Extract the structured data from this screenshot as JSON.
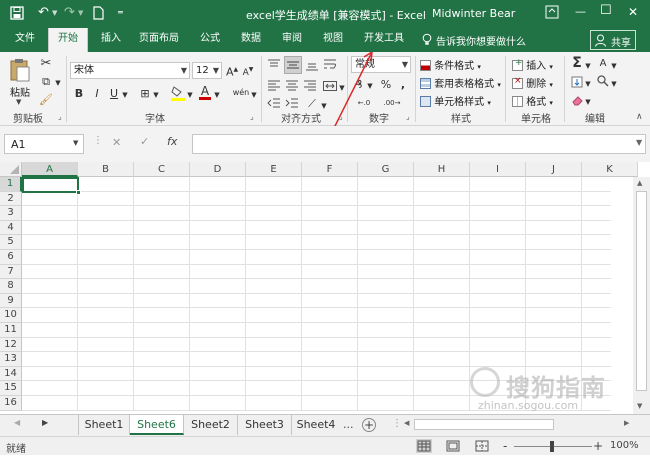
{
  "titlebar": {
    "title": "excel学生成绩单  [兼容模式]  -  Excel",
    "user": "Midwinter Bear",
    "save_icon": "save-icon",
    "undo_icon": "undo-icon",
    "redo_icon": "redo-icon",
    "new_icon": "new-file-icon",
    "customize_icon": "customize-toolbar-icon",
    "ribbon_options_icon": "ribbon-display-icon",
    "minimize_glyph": "—",
    "restore_glyph": "☐",
    "close_glyph": "✕"
  },
  "menu": {
    "tabs": [
      "文件",
      "开始",
      "插入",
      "页面布局",
      "公式",
      "数据",
      "审阅",
      "视图",
      "开发工具"
    ],
    "active_tab": "开始",
    "tell_me": "告诉我你想要做什么",
    "share": "共享"
  },
  "ribbon": {
    "clipboard": {
      "label": "剪贴板",
      "paste": "粘贴"
    },
    "font": {
      "label": "字体",
      "font_name": "宋体",
      "font_size": "12",
      "grow": "A",
      "shrink": "A",
      "bold": "B",
      "italic": "I",
      "underline": "U",
      "font_color_letter": "A",
      "phonetic": "wén"
    },
    "alignment": {
      "label": "对齐方式"
    },
    "number": {
      "label": "数字",
      "format": "常规",
      "percent": "%",
      "comma": ","
    },
    "styles": {
      "label": "样式",
      "conditional": "条件格式",
      "table": "套用表格格式",
      "cell_styles": "单元格样式"
    },
    "cells": {
      "label": "单元格",
      "insert": "插入",
      "delete": "删除",
      "format": "格式"
    },
    "editing": {
      "label": "编辑",
      "sum": "Σ"
    }
  },
  "formula_bar": {
    "name_box": "A1",
    "cancel": "✕",
    "enter": "✓",
    "fx": "fx",
    "value": ""
  },
  "grid": {
    "columns": [
      "A",
      "B",
      "C",
      "D",
      "E",
      "F",
      "G",
      "H",
      "I",
      "J",
      "K"
    ],
    "rows": [
      "1",
      "2",
      "3",
      "4",
      "5",
      "6",
      "7",
      "8",
      "9",
      "10",
      "11",
      "12",
      "13",
      "14",
      "15",
      "16"
    ],
    "active_cell": "A1"
  },
  "sheets": {
    "tabs": [
      "Sheet1",
      "Sheet6",
      "Sheet2",
      "Sheet3",
      "Sheet4"
    ],
    "active": "Sheet6",
    "more": "...",
    "add": "+"
  },
  "status": {
    "mode": "就绪",
    "zoom": "100%",
    "zoom_minus": "-",
    "zoom_plus": "+"
  },
  "watermark": {
    "text": "搜狗指南",
    "url_text": "zhinan.sogou.com"
  },
  "colors": {
    "excel_green": "#217346",
    "annotation_red": "#d9292b"
  }
}
